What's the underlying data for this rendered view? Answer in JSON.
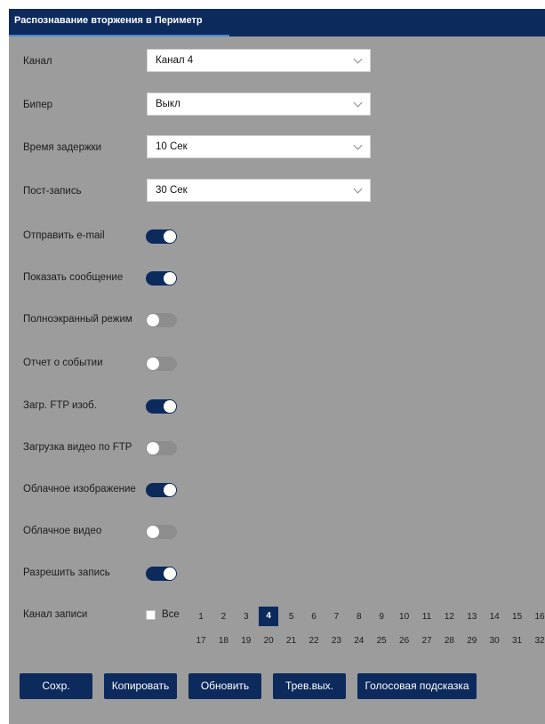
{
  "header": {
    "title": "Распознавание вторжения в Периметр"
  },
  "selects": [
    {
      "label": "Канал",
      "value": "Канал 4"
    },
    {
      "label": "Бипер",
      "value": "Выкл"
    },
    {
      "label": "Время задержки",
      "value": "10  Сек"
    },
    {
      "label": "Пост-запись",
      "value": "30  Сек"
    }
  ],
  "toggles": [
    {
      "label": "Отправить e-mail",
      "state": "on"
    },
    {
      "label": "Показать сообщение",
      "state": "on"
    },
    {
      "label": "Полноэкранный режим",
      "state": "off"
    },
    {
      "label": "Отчет о событии",
      "state": "off"
    },
    {
      "label": "Загр. FTP изоб.",
      "state": "on"
    },
    {
      "label": "Загрузка видео по FTP",
      "state": "off"
    },
    {
      "label": "Облачное изображение",
      "state": "on"
    },
    {
      "label": "Облачное видео",
      "state": "off"
    },
    {
      "label": "Разрешить запись",
      "state": "on"
    }
  ],
  "record_channel": {
    "label": "Канал записи",
    "all_label": "Все",
    "all_checked": false,
    "row1": [
      "1",
      "2",
      "3",
      "4",
      "5",
      "6",
      "7",
      "8",
      "9",
      "10",
      "11",
      "12",
      "13",
      "14",
      "15",
      "16"
    ],
    "row2": [
      "17",
      "18",
      "19",
      "20",
      "21",
      "22",
      "23",
      "24",
      "25",
      "26",
      "27",
      "28",
      "29",
      "30",
      "31",
      "32"
    ],
    "selected": "4"
  },
  "buttons": {
    "save": "Сохр.",
    "copy": "Копировать",
    "refresh": "Обновить",
    "alarm_out": "Трев.вых.",
    "voice": "Голосовая подсказка"
  },
  "colors": {
    "accent": "#0c2a5c",
    "panel": "#9c9c9c",
    "toggle_off": "#8d8d8d"
  }
}
